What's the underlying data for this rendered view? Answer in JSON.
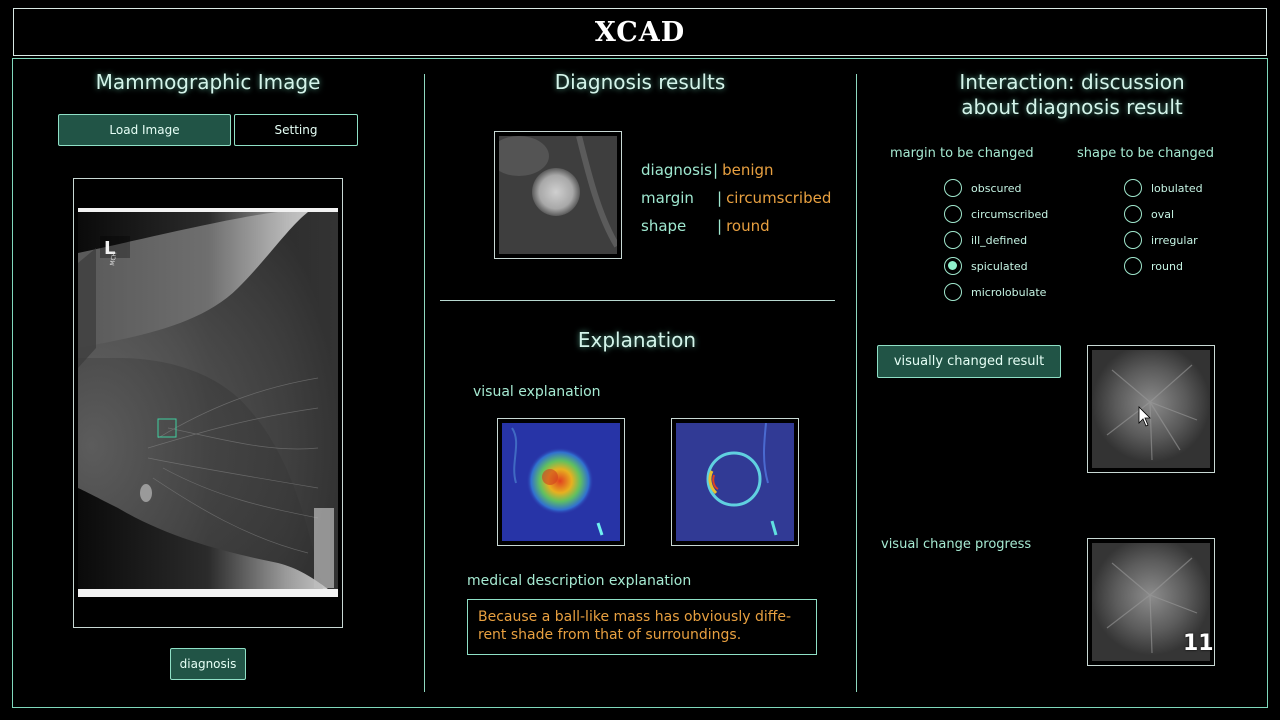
{
  "app": {
    "title": "XCAD"
  },
  "left": {
    "heading": "Mammographic Image",
    "load_button": "Load Image",
    "setting_button": "Setting",
    "film_marker": "L",
    "film_marker_small": "MCH",
    "diagnosis_button": "diagnosis"
  },
  "middle": {
    "heading": "Diagnosis results",
    "results": [
      {
        "key": "diagnosis",
        "value": "benign"
      },
      {
        "key": "margin",
        "value": "circumscribed"
      },
      {
        "key": "shape",
        "value": "round"
      }
    ],
    "explanation_heading": "Explanation",
    "visual_explanation_label": "visual explanation",
    "medical_description_label": "medical description explanation",
    "medical_description_line1": "Because a ball-like mass has obviously diffe-",
    "medical_description_line2": "rent shade from that of surroundings."
  },
  "right": {
    "heading_line1": "Interaction: discussion",
    "heading_line2": "about diagnosis result",
    "margin_label": "margin to be changed",
    "shape_label": "shape to be changed",
    "margin_options": [
      {
        "label": "obscured",
        "selected": false
      },
      {
        "label": "circumscribed",
        "selected": false
      },
      {
        "label": "ill_defined",
        "selected": false
      },
      {
        "label": "spiculated",
        "selected": true
      },
      {
        "label": "microlobulate",
        "selected": false
      }
    ],
    "shape_options": [
      {
        "label": "lobulated",
        "selected": false
      },
      {
        "label": "oval",
        "selected": false
      },
      {
        "label": "irregular",
        "selected": false
      },
      {
        "label": "round",
        "selected": false
      }
    ],
    "changed_button": "visually changed result",
    "progress_label": "visual change progress",
    "progress_counter": "11"
  },
  "colors": {
    "accent": "#215446",
    "border": "#8fe0c6",
    "value": "#e8a040"
  }
}
